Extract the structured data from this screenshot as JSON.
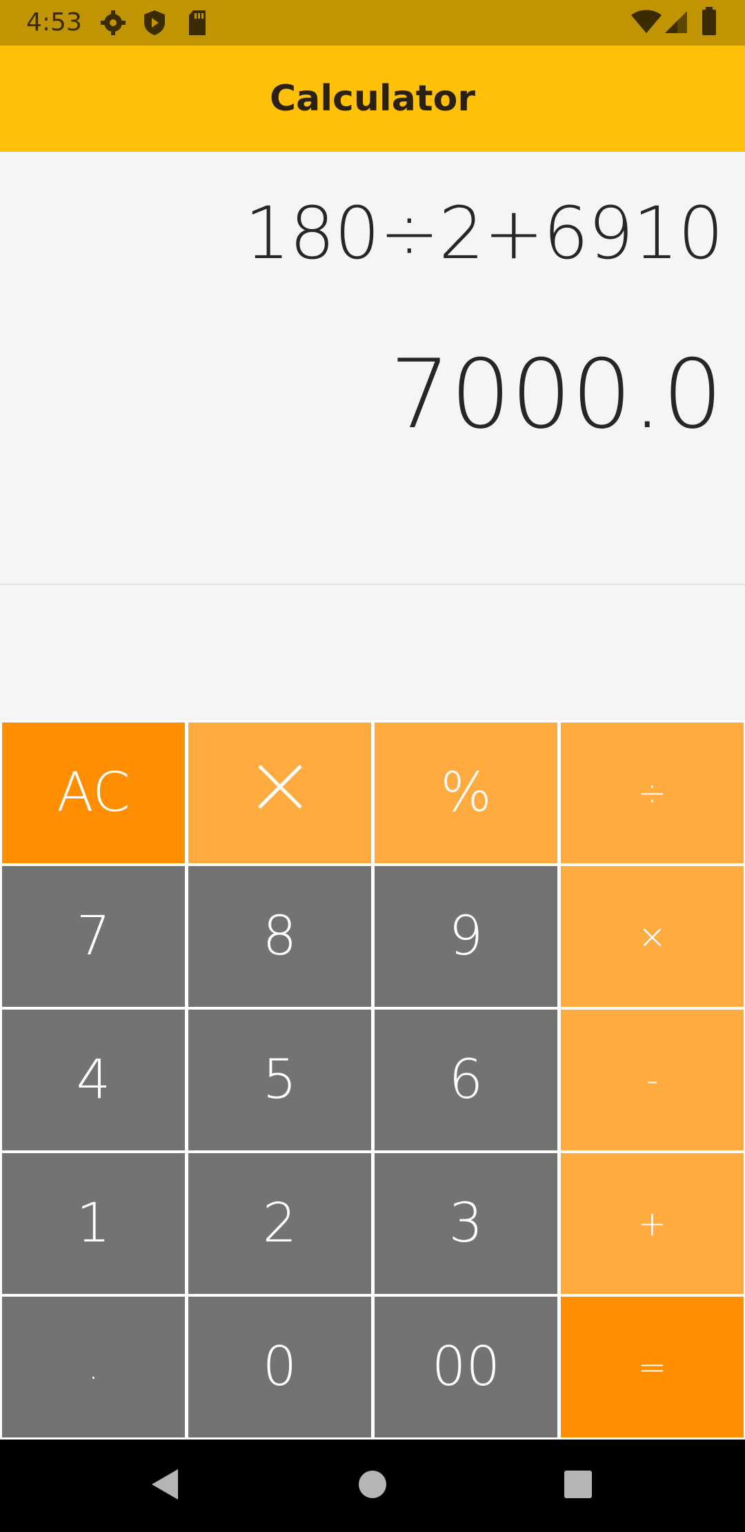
{
  "status_bar": {
    "time": "4:53",
    "left_icons": [
      "gear-icon",
      "shield-play-icon",
      "sd-card-icon"
    ],
    "right_icons": [
      "wifi-icon",
      "cell-signal-icon",
      "battery-icon"
    ]
  },
  "app_bar": {
    "title": "Calculator",
    "color": "#ffc107"
  },
  "display": {
    "expression": "180÷2+6910",
    "result": "7000.0"
  },
  "keypad": {
    "rows": [
      [
        {
          "label": "AC",
          "style": "accent"
        },
        {
          "label": "⌫",
          "icon": "backspace-x-icon",
          "style": "op"
        },
        {
          "label": "%",
          "style": "op"
        },
        {
          "label": "÷",
          "style": "op"
        }
      ],
      [
        {
          "label": "7",
          "style": "num"
        },
        {
          "label": "8",
          "style": "num"
        },
        {
          "label": "9",
          "style": "num"
        },
        {
          "label": "×",
          "style": "op"
        }
      ],
      [
        {
          "label": "4",
          "style": "num"
        },
        {
          "label": "5",
          "style": "num"
        },
        {
          "label": "6",
          "style": "num"
        },
        {
          "label": "-",
          "style": "op"
        }
      ],
      [
        {
          "label": "1",
          "style": "num"
        },
        {
          "label": "2",
          "style": "num"
        },
        {
          "label": "3",
          "style": "num"
        },
        {
          "label": "+",
          "style": "op"
        }
      ],
      [
        {
          "label": ".",
          "style": "num"
        },
        {
          "label": "0",
          "style": "num"
        },
        {
          "label": "00",
          "style": "num"
        },
        {
          "label": "=",
          "style": "accent"
        }
      ]
    ],
    "colors": {
      "number": "#737373",
      "operator": "#ffab40",
      "accent": "#ff8f00"
    }
  },
  "nav_bar": {
    "icons": [
      "back-triangle-icon",
      "home-circle-icon",
      "recents-square-icon"
    ]
  }
}
